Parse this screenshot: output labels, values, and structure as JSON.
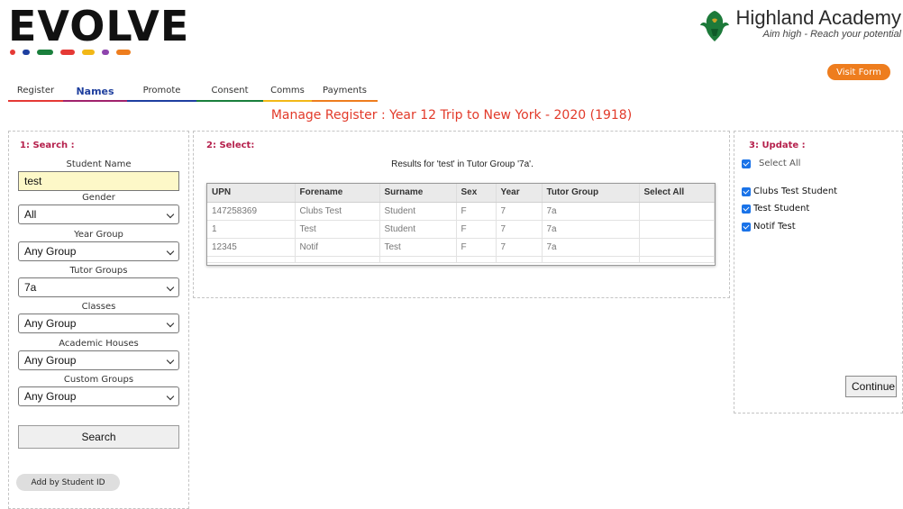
{
  "header": {
    "logo_text": "EVOLVE",
    "logo_dots": [
      "#e53935",
      "#1e3fa0",
      "#1a7f3c",
      "#e53935",
      "#f2b817",
      "#8e44ad",
      "#ee7d1e"
    ],
    "school_name": "Highland Academy",
    "school_motto": "Aim high - Reach your potential",
    "visit_form_label": "Visit Form"
  },
  "tabs": [
    {
      "label": "Register",
      "color": "#e53935",
      "active": false
    },
    {
      "label": "Names",
      "color": "#a0226d",
      "active": true
    },
    {
      "label": "Promote",
      "color": "#1e3fa0",
      "active": false
    },
    {
      "label": "Consent",
      "color": "#1a7f3c",
      "active": false
    },
    {
      "label": "Comms",
      "color": "#f2b817",
      "active": false
    },
    {
      "label": "Payments",
      "color": "#ee7d1e",
      "active": false
    }
  ],
  "page_title": "Manage Register : Year 12 Trip to New York - 2020 (1918)",
  "search_panel": {
    "heading": "1: Search :",
    "student_name_label": "Student Name",
    "student_name_value": "test",
    "gender_label": "Gender",
    "gender_value": "All",
    "year_group_label": "Year Group",
    "year_group_value": "Any Group",
    "tutor_groups_label": "Tutor Groups",
    "tutor_groups_value": "7a",
    "classes_label": "Classes",
    "classes_value": "Any Group",
    "houses_label": "Academic Houses",
    "houses_value": "Any Group",
    "custom_label": "Custom Groups",
    "custom_value": "Any Group",
    "search_button": "Search",
    "add_by_id_button": "Add by Student ID"
  },
  "select_panel": {
    "heading": "2: Select:",
    "results_caption": "Results for 'test' in Tutor Group '7a'.",
    "columns": [
      "UPN",
      "Forename",
      "Surname",
      "Sex",
      "Year",
      "Tutor Group",
      "Select All"
    ],
    "rows": [
      [
        "147258369",
        "Clubs Test",
        "Student",
        "F",
        "7",
        "7a",
        ""
      ],
      [
        "1",
        "Test",
        "Student",
        "F",
        "7",
        "7a",
        ""
      ],
      [
        "12345",
        "Notif",
        "Test",
        "F",
        "7",
        "7a",
        ""
      ]
    ]
  },
  "update_panel": {
    "heading": "3: Update :",
    "select_all_label": "Select All",
    "students": [
      "Clubs Test Student",
      "Test Student",
      "Notif Test"
    ],
    "continue_button": "Continue"
  }
}
